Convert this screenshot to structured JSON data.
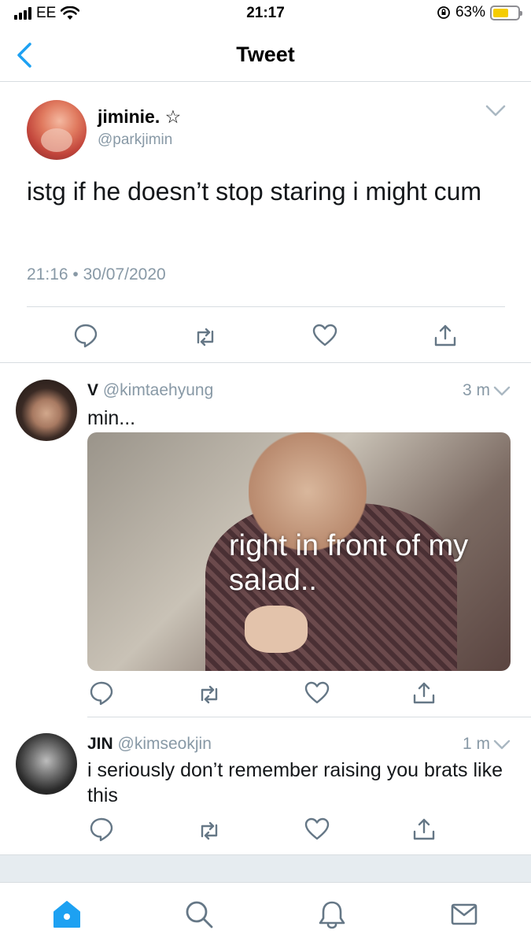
{
  "status_bar": {
    "carrier": "EE",
    "time": "21:17",
    "battery": "63%",
    "battery_level": 0.63
  },
  "nav": {
    "title": "Tweet"
  },
  "main_tweet": {
    "name": "jiminie. ☆",
    "handle": "@parkjimin",
    "text": "istg if he doesn’t stop staring i might cum",
    "timestamp": "21:16 • 30/07/2020"
  },
  "replies": [
    {
      "name": "V",
      "handle": "@kimtaehyung",
      "time": "3 m",
      "text": "min...",
      "media_caption": "right in front of my salad.."
    },
    {
      "name": "JIN",
      "handle": "@kimseokjin",
      "time": "1 m",
      "text": "i seriously don’t remember raising you brats like this"
    }
  ],
  "colors": {
    "accent": "#1da1f2",
    "icon_gray": "#8899a6",
    "divider": "#d8dde1",
    "battery_fill": "#f5cc00"
  },
  "icons": {
    "actions": [
      "reply-icon",
      "retweet-icon",
      "like-icon",
      "share-icon"
    ],
    "tabs": [
      "home-icon",
      "search-icon",
      "notifications-icon",
      "messages-icon"
    ]
  }
}
